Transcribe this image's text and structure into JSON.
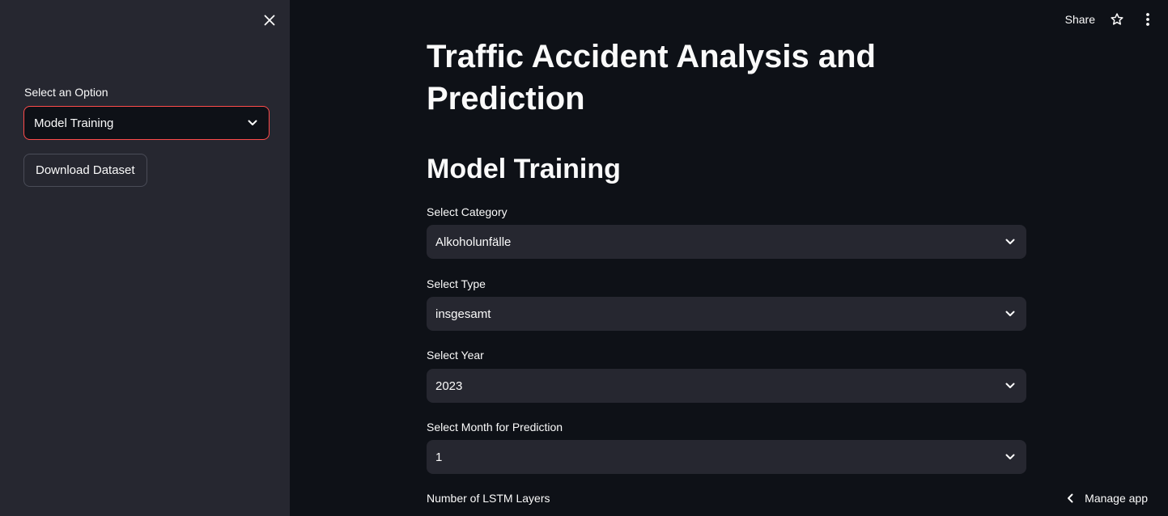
{
  "sidebar": {
    "select_label": "Select an Option",
    "select_value": "Model Training",
    "download_label": "Download Dataset"
  },
  "toolbar": {
    "share_label": "Share"
  },
  "main": {
    "title": "Traffic Accident Analysis and Prediction",
    "section_title": "Model Training",
    "fields": [
      {
        "label": "Select Category",
        "value": "Alkoholunfälle"
      },
      {
        "label": "Select Type",
        "value": "insgesamt"
      },
      {
        "label": "Select Year",
        "value": "2023"
      },
      {
        "label": "Select Month for Prediction",
        "value": "1"
      }
    ],
    "lstm_label": "Number of LSTM Layers"
  },
  "footer": {
    "manage_label": "Manage app"
  },
  "colors": {
    "background": "#0e1117",
    "sidebar": "#262730",
    "accent": "#ff4b4b"
  },
  "icons": [
    "close-icon",
    "star-icon",
    "more-vert-icon",
    "chevron-down-icon",
    "chevron-left-icon"
  ]
}
